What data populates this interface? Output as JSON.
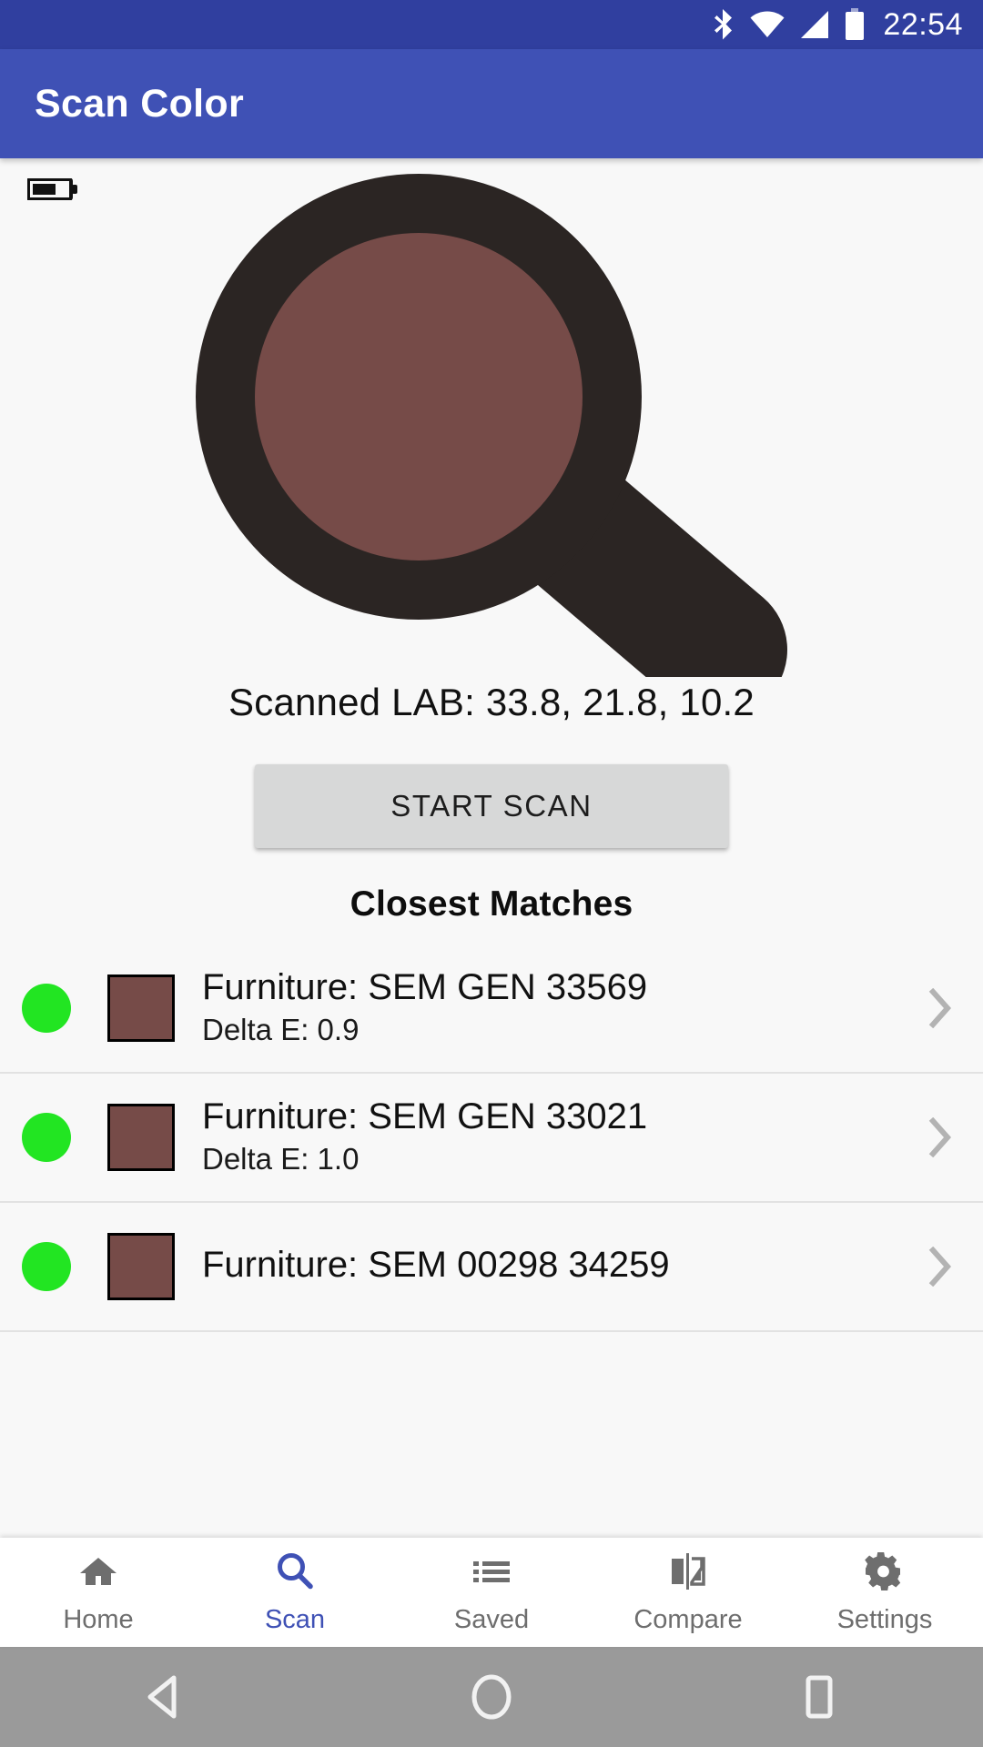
{
  "status_bar": {
    "time": "22:54",
    "icons": [
      "bluetooth-icon",
      "wifi-icon",
      "cellular-signal-icon",
      "battery-icon"
    ]
  },
  "app_bar": {
    "title": "Scan Color"
  },
  "main": {
    "device_battery_icon": "battery-horizontal-icon",
    "hero_icon": "magnifier-color-preview-icon",
    "scanned_color_hex": "#764B48",
    "magnifier_frame_hex": "#2B2523",
    "scanned_lab_label": "Scanned LAB: 33.8, 21.8, 10.2",
    "start_scan_label": "START SCAN",
    "matches_heading": "Closest Matches",
    "matches": [
      {
        "status_dot_hex": "#22E522",
        "swatch_hex": "#764B48",
        "title": "Furniture: SEM GEN 33569",
        "delta": "Delta E: 0.9",
        "chevron": "chevron-right-icon"
      },
      {
        "status_dot_hex": "#22E522",
        "swatch_hex": "#764B48",
        "title": "Furniture: SEM GEN 33021",
        "delta": "Delta E: 1.0",
        "chevron": "chevron-right-icon"
      },
      {
        "status_dot_hex": "#22E522",
        "swatch_hex": "#764B48",
        "title": "Furniture: SEM 00298 34259",
        "delta": "",
        "chevron": "chevron-right-icon"
      }
    ]
  },
  "bottom_nav": {
    "active_color": "#3f51b5",
    "inactive_color": "#6e6e6e",
    "items": [
      {
        "label": "Home",
        "icon": "home-icon",
        "active": false
      },
      {
        "label": "Scan",
        "icon": "search-icon",
        "active": true
      },
      {
        "label": "Saved",
        "icon": "list-icon",
        "active": false
      },
      {
        "label": "Compare",
        "icon": "compare-flip-icon",
        "active": false
      },
      {
        "label": "Settings",
        "icon": "gear-icon",
        "active": false
      }
    ]
  },
  "android_nav": {
    "back": "back-triangle-icon",
    "home": "home-circle-icon",
    "recents": "recents-square-icon"
  }
}
